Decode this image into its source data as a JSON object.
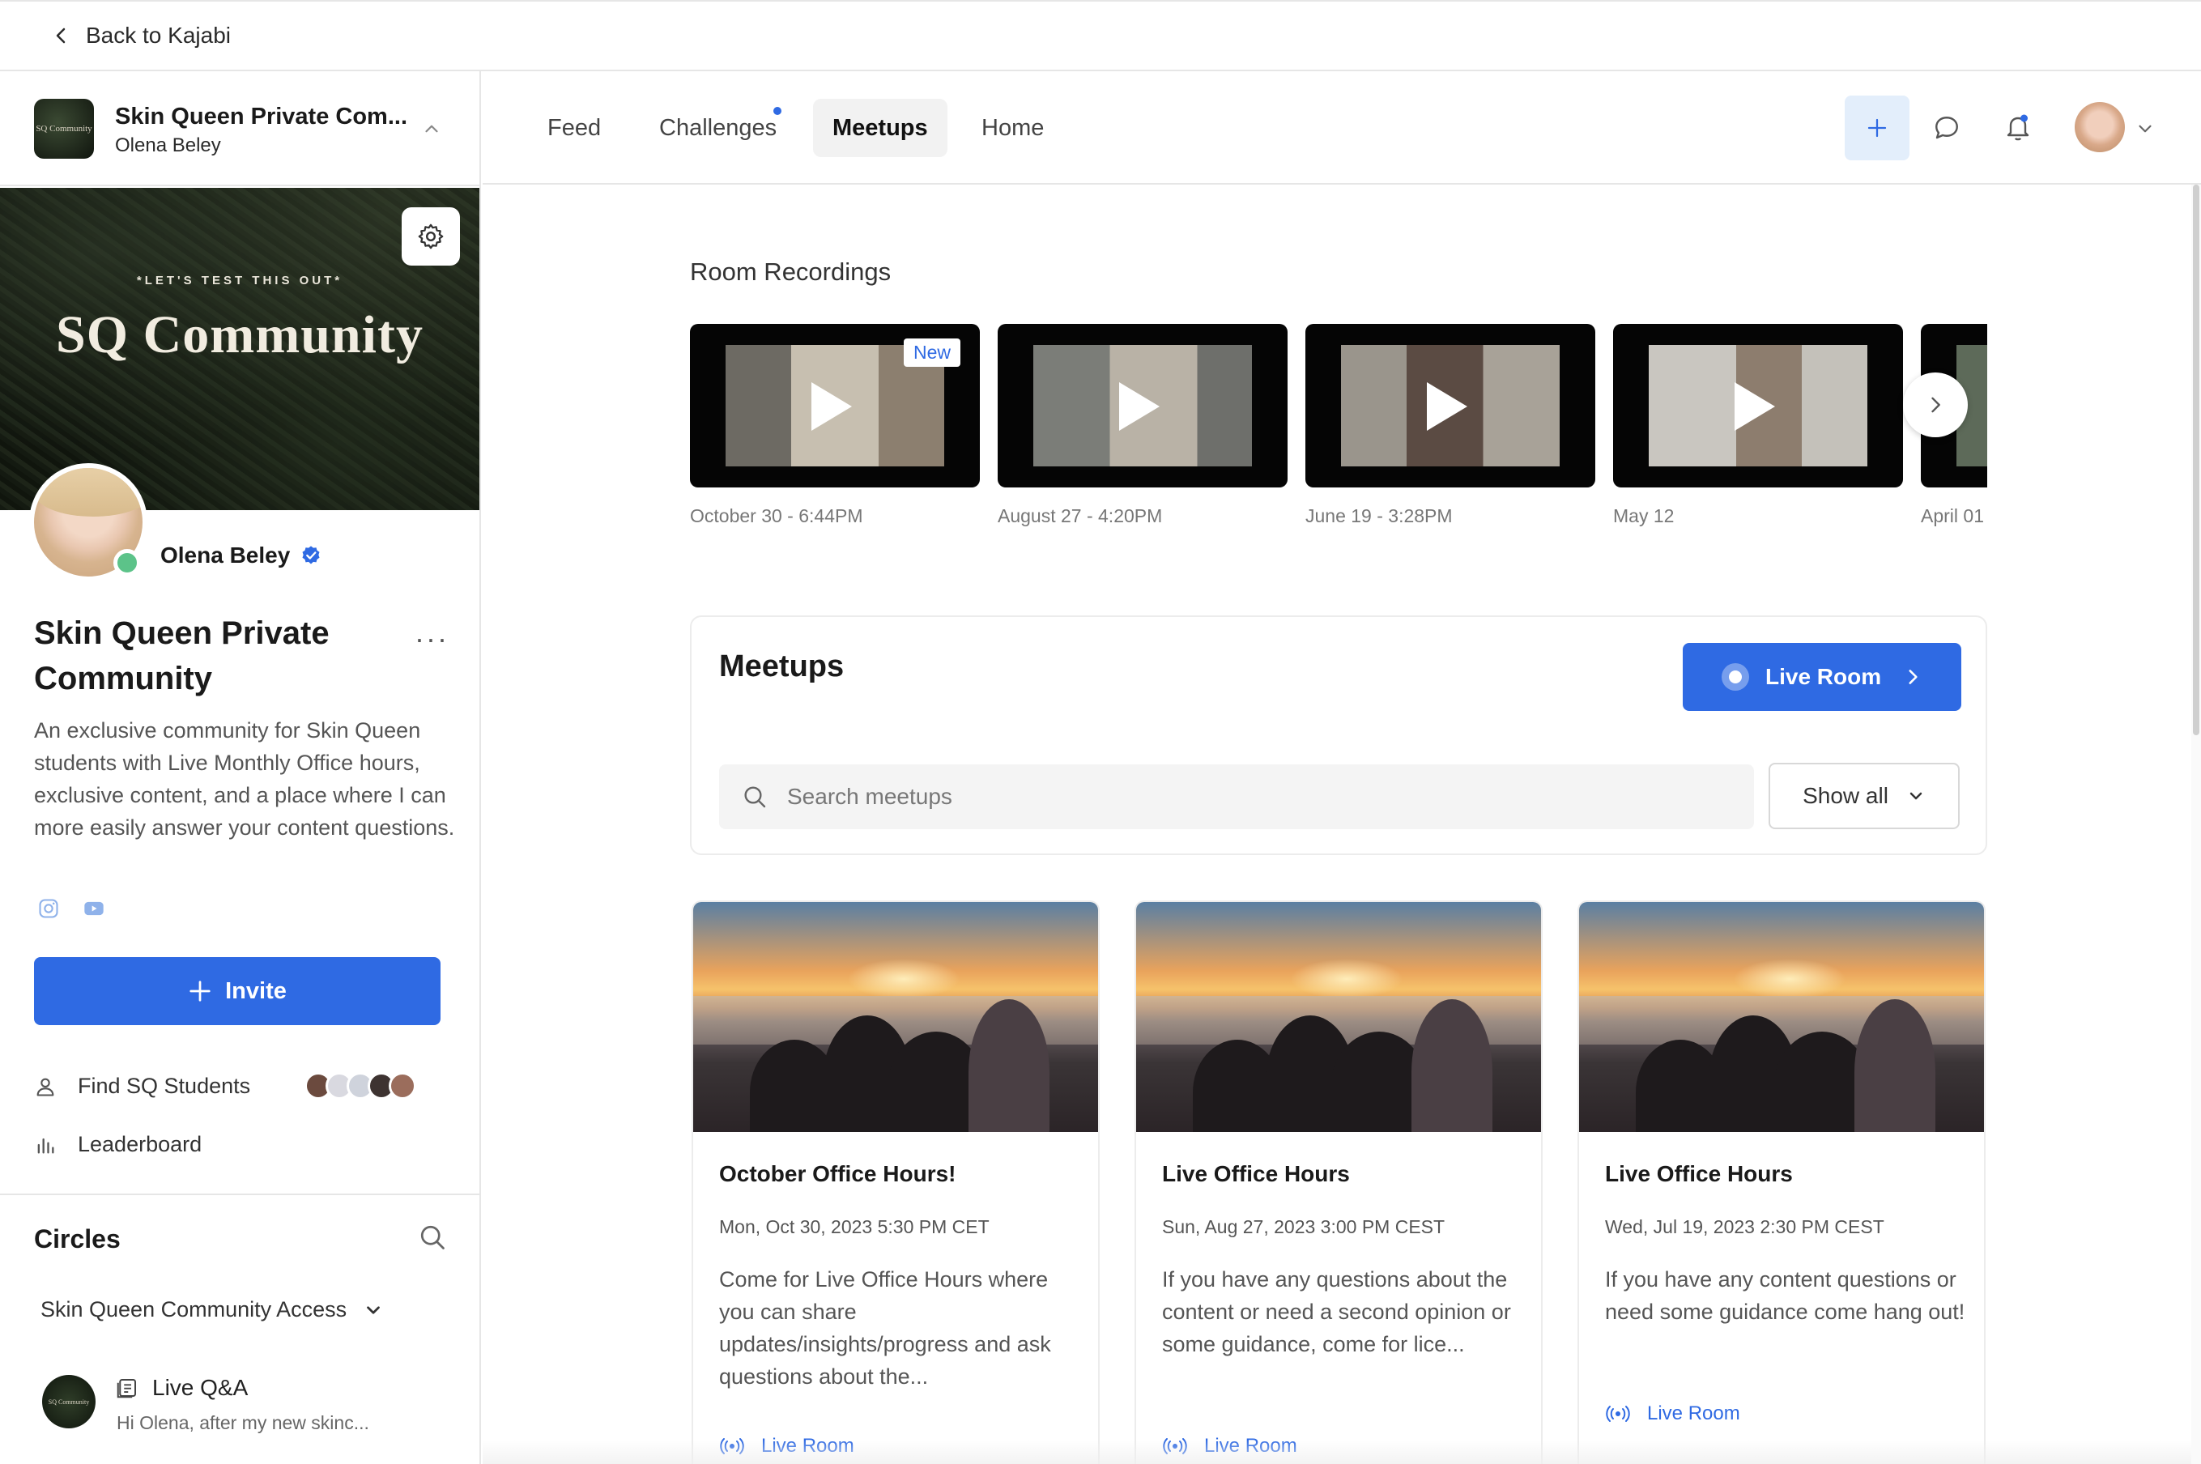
{
  "topbar": {
    "back_label": "Back to Kajabi"
  },
  "community": {
    "name": "Skin Queen Private Com...",
    "owner": "Olena Beley",
    "logo_text": "SQ Community"
  },
  "cover": {
    "tagline": "*LET'S TEST THIS OUT*",
    "title": "SQ Community"
  },
  "profile": {
    "name": "Olena Beley",
    "about_title": "Skin Queen Private Community",
    "description": "An exclusive community for Skin Queen students with Live Monthly Office hours, exclusive content, and a place where I can more easily answer your content questions.",
    "more": "···"
  },
  "sidebar": {
    "invite_label": "Invite",
    "find_label": "Find SQ Students",
    "leaderboard_label": "Leaderboard",
    "circles_title": "Circles",
    "circle_group": "Skin Queen Community Access",
    "chat": {
      "title": "Live Q&A",
      "preview": "Hi Olena, after my new skinc..."
    }
  },
  "nav": {
    "tabs": [
      {
        "label": "Feed"
      },
      {
        "label": "Challenges"
      },
      {
        "label": "Meetups"
      },
      {
        "label": "Home"
      }
    ],
    "active_tab": "Meetups"
  },
  "recordings": {
    "title": "Room Recordings",
    "new_badge": "New",
    "items": [
      {
        "date": "October 30 - 6:44PM"
      },
      {
        "date": "August 27 - 4:20PM"
      },
      {
        "date": "June 19 - 3:28PM"
      },
      {
        "date": "May 12"
      },
      {
        "date": "April 01"
      }
    ]
  },
  "meetups": {
    "title": "Meetups",
    "live_room_label": "Live Room",
    "search_placeholder": "Search meetups",
    "filter_label": "Show all",
    "cards": [
      {
        "title": "October Office Hours!",
        "date": "Mon, Oct 30, 2023 5:30 PM CET",
        "description": "Come for Live Office Hours where you can share updates/insights/progress and ask questions about the...",
        "link": "Live Room"
      },
      {
        "title": "Live Office Hours",
        "date": "Sun, Aug 27, 2023 3:00 PM CEST",
        "description": "If you have any questions about the content or need a second opinion or some guidance, come for lice...",
        "link": "Live Room"
      },
      {
        "title": "Live Office Hours",
        "date": "Wed, Jul 19, 2023 2:30 PM CEST",
        "description": "If you have any content questions or need some guidance come hang out!",
        "link": "Live Room"
      }
    ]
  },
  "colors": {
    "accent": "#2f6ae3",
    "online": "#5cc389",
    "border": "#e6e6e6"
  }
}
